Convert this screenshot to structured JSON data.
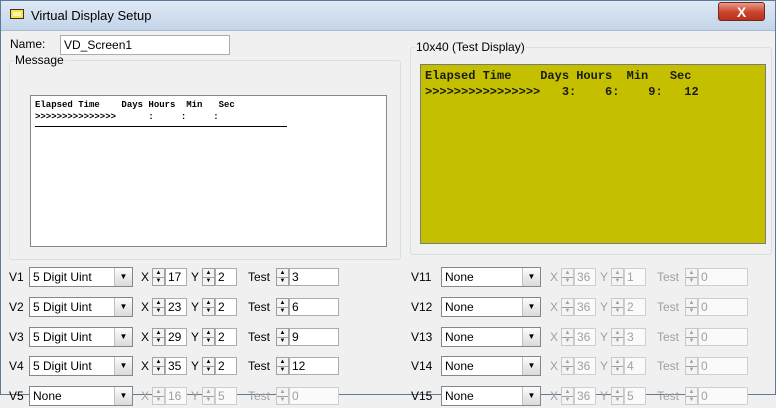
{
  "window": {
    "title": "Virtual Display Setup",
    "close_label": "X"
  },
  "name_label": "Name:",
  "name_value": "VD_Screen1",
  "message_group": "Message",
  "message_lines": [
    "Elapsed Time    Days Hours  Min   Sec",
    ">>>>>>>>>>>>>>>      :     :     :"
  ],
  "test_group": "10x40 (Test Display)",
  "lcd_lines": [
    "Elapsed Time    Days Hours  Min   Sec",
    ">>>>>>>>>>>>>>>>   3:    6:    9:   12"
  ],
  "colors": {
    "lcd_background": "#c4c000",
    "close_button": "#c8432c"
  },
  "left_rows": [
    {
      "label": "V1",
      "type": "5 Digit Uint",
      "x": "17",
      "y": "2",
      "test": "3",
      "enabled": true
    },
    {
      "label": "V2",
      "type": "5 Digit Uint",
      "x": "23",
      "y": "2",
      "test": "6",
      "enabled": true
    },
    {
      "label": "V3",
      "type": "5 Digit Uint",
      "x": "29",
      "y": "2",
      "test": "9",
      "enabled": true
    },
    {
      "label": "V4",
      "type": "5 Digit Uint",
      "x": "35",
      "y": "2",
      "test": "12",
      "enabled": true
    },
    {
      "label": "V5",
      "type": "None",
      "x": "16",
      "y": "5",
      "test": "0",
      "enabled": false
    }
  ],
  "right_rows": [
    {
      "label": "V11",
      "type": "None",
      "x": "36",
      "y": "1",
      "test": "0",
      "enabled": false
    },
    {
      "label": "V12",
      "type": "None",
      "x": "36",
      "y": "2",
      "test": "0",
      "enabled": false
    },
    {
      "label": "V13",
      "type": "None",
      "x": "36",
      "y": "3",
      "test": "0",
      "enabled": false
    },
    {
      "label": "V14",
      "type": "None",
      "x": "36",
      "y": "4",
      "test": "0",
      "enabled": false
    },
    {
      "label": "V15",
      "type": "None",
      "x": "36",
      "y": "5",
      "test": "0",
      "enabled": false
    }
  ],
  "axis_labels": {
    "x": "X",
    "y": "Y",
    "test": "Test"
  },
  "icons": {
    "title": "display-icon",
    "dropdown": "chevron-down-icon",
    "spin": "spin-arrows-icon"
  }
}
